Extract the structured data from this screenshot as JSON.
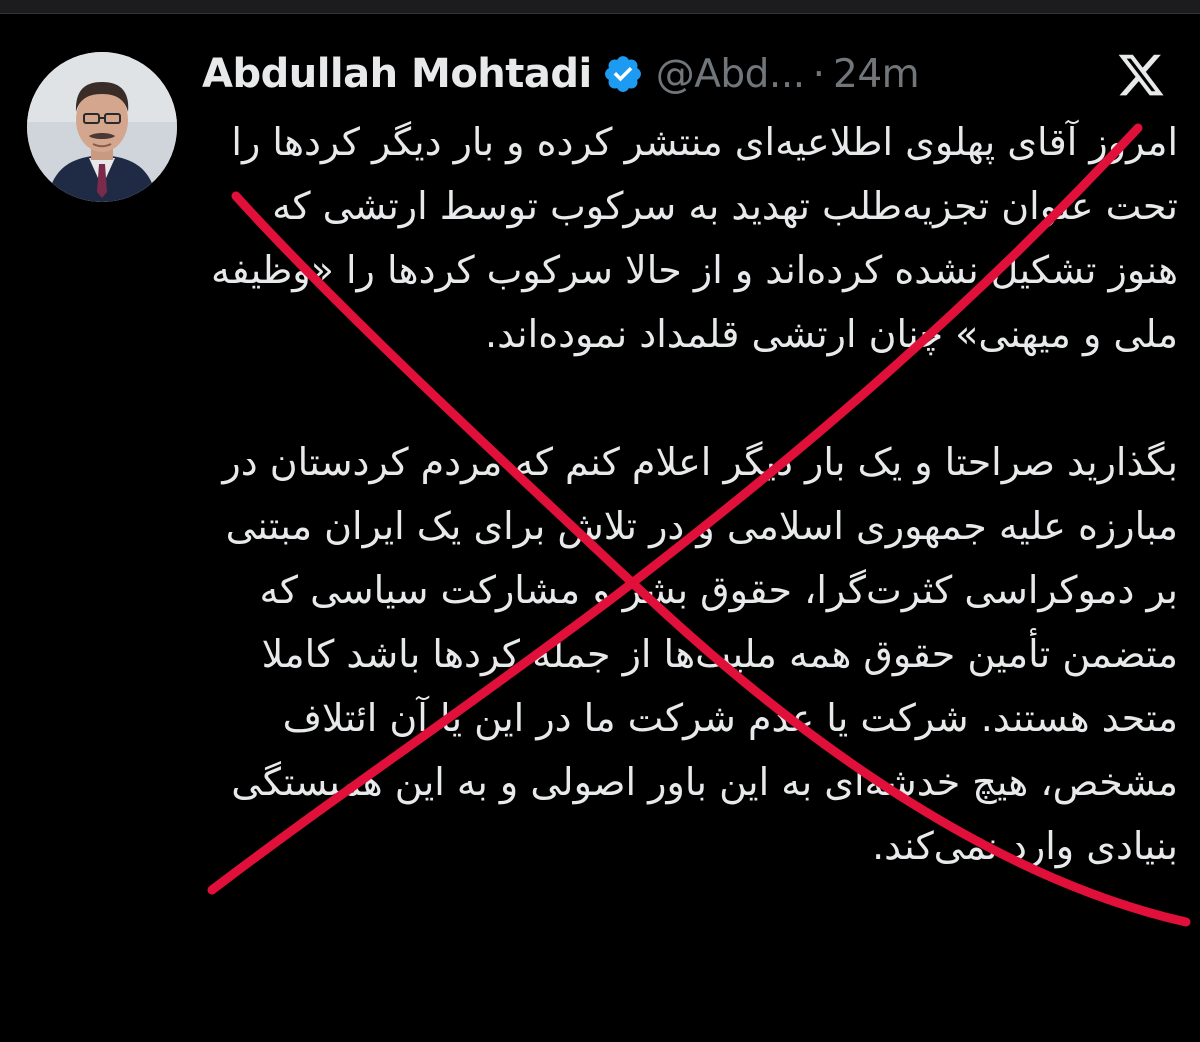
{
  "tweet": {
    "author": {
      "display_name": "Abdullah Mohtadi",
      "handle": "@Abd...",
      "verified": true,
      "verified_icon": "verified-badge-icon",
      "avatar_icon": "avatar"
    },
    "separator": "·",
    "timestamp": "24m",
    "platform_icon": "x-logo-icon",
    "paragraphs": [
      "امروز آقای پهلوی اطلاعیه‌ای منتشر کرده و بار دیگر کردها را تحت عنوان تجزیه‌طلب تهدید به سرکوب توسط ارتشی که هنوز تشکیل نشده کرده‌اند و از حالا سرکوب کردها را «وظیفه ملی و میهنی» چنان ارتشی قلمداد نموده‌اند.",
      "بگذارید صراحتا و یک بار دیگر اعلام کنم که مردم کردستان در مبارزه علیه جمهوری اسلامی و در تلاش برای یک ایران مبتنی بر دموکراسی کثرت‌گرا، حقوق بشر و مشارکت سیاسی که متضمن تأمین حقوق همه ملیت‌ها از جمله کردها باشد کاملا متحد هستند. شرکت یا عدم شرکت ما در این یا آن ائتلاف مشخص، هیچ خدشه‌ای به این باور اصولی و به این همبستگی بنیادی وارد نمی‌کند."
    ]
  },
  "colors": {
    "background": "#000000",
    "text_primary": "#e7e9ea",
    "text_secondary": "#71767b",
    "verified_blue": "#1d9bf0",
    "cross_mark": "#e0103a"
  },
  "overlay": {
    "type": "red-cross-mark",
    "icon": "cross-out-mark"
  }
}
